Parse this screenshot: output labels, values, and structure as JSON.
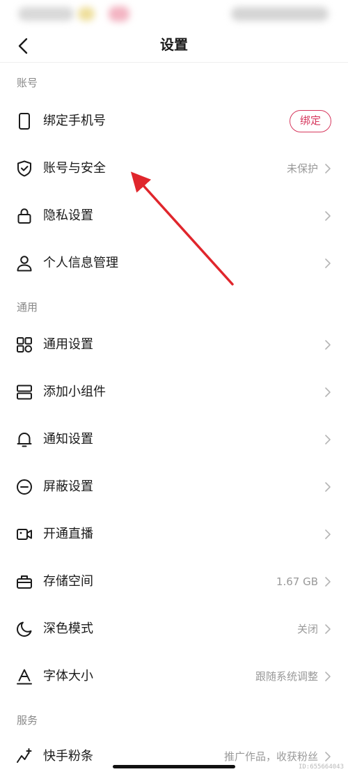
{
  "header": {
    "title": "设置"
  },
  "sections": {
    "account": "账号",
    "general": "通用",
    "services": "服务"
  },
  "account_items": {
    "phone": {
      "label": "绑定手机号",
      "button": "绑定"
    },
    "security": {
      "label": "账号与安全",
      "value": "未保护"
    },
    "privacy": {
      "label": "隐私设置"
    },
    "personal": {
      "label": "个人信息管理"
    }
  },
  "general_items": {
    "general_settings": {
      "label": "通用设置"
    },
    "widget": {
      "label": "添加小组件"
    },
    "notify": {
      "label": "通知设置"
    },
    "block": {
      "label": "屏蔽设置"
    },
    "live": {
      "label": "开通直播"
    },
    "storage": {
      "label": "存储空间",
      "value": "1.67 GB"
    },
    "dark": {
      "label": "深色模式",
      "value": "关闭"
    },
    "font": {
      "label": "字体大小",
      "value": "跟随系统调整"
    }
  },
  "service_items": {
    "fans": {
      "label": "快手粉条",
      "value": "推广作品，收获粉丝"
    }
  },
  "watermark": "ID:655664043",
  "colors": {
    "accent": "#d6375d",
    "annotation_arrow": "#e0262c"
  }
}
